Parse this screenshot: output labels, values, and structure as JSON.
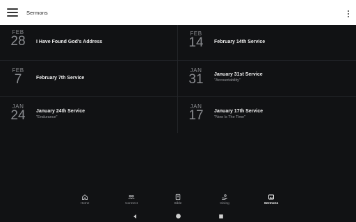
{
  "appbar": {
    "title": "Sermons",
    "menu_icon": "hamburger-menu-icon",
    "overflow_icon": "more-vertical-icon"
  },
  "sermons": [
    {
      "month": "FEB",
      "day": "28",
      "title": "I Have Found God's Address",
      "subtitle": ""
    },
    {
      "month": "FEB",
      "day": "14",
      "title": "February 14th Service",
      "subtitle": ""
    },
    {
      "month": "FEB",
      "day": "7",
      "title": "February 7th Service",
      "subtitle": ""
    },
    {
      "month": "JAN",
      "day": "31",
      "title": "January 31st Service",
      "subtitle": "\"Accountability\""
    },
    {
      "month": "JAN",
      "day": "24",
      "title": "January 24th Service",
      "subtitle": "\"Endurance\""
    },
    {
      "month": "JAN",
      "day": "17",
      "title": "January 17th Service",
      "subtitle": "\"Now Is The Time\""
    }
  ],
  "bottom_nav": [
    {
      "label": "Home",
      "icon": "home-icon",
      "active": false
    },
    {
      "label": "Connect",
      "icon": "people-icon",
      "active": false
    },
    {
      "label": "Bible",
      "icon": "book-icon",
      "active": false
    },
    {
      "label": "Giving",
      "icon": "giving-hand-icon",
      "active": false
    },
    {
      "label": "Sermons",
      "icon": "image-icon",
      "active": true
    }
  ],
  "colors": {
    "background": "#111214",
    "appbar": "#ffffff",
    "divider": "#24262a",
    "text_primary": "#f2f2f2",
    "text_muted": "#8a8c90"
  }
}
